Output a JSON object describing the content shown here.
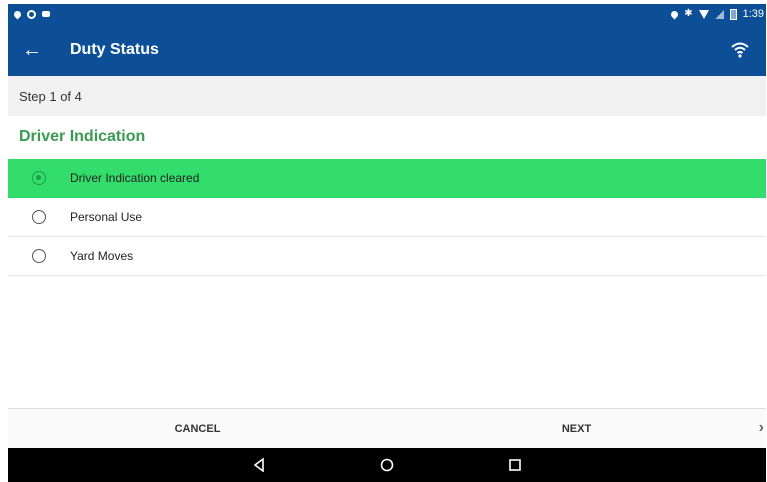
{
  "status_bar": {
    "time": "1:39",
    "left_icons": [
      "location-icon",
      "shield-icon",
      "message-icon"
    ],
    "right_icons": [
      "location-icon",
      "bluetooth-icon",
      "wifi-icon",
      "signal-icon",
      "battery-icon"
    ]
  },
  "app_bar": {
    "title": "Duty Status",
    "back_icon": "arrow-back-icon",
    "right_icon": "wifi-icon",
    "color": "#0d4f97"
  },
  "step": {
    "text": "Step 1 of 4"
  },
  "section": {
    "title": "Driver Indication",
    "color": "#3a9a52"
  },
  "options": [
    {
      "label": "Driver Indication cleared",
      "selected": true
    },
    {
      "label": "Personal Use",
      "selected": false
    },
    {
      "label": "Yard Moves",
      "selected": false
    }
  ],
  "selected_color": "#33dd6b",
  "footer": {
    "cancel_label": "CANCEL",
    "next_label": "NEXT",
    "chevron_icon": "chevron-right-icon"
  },
  "nav_bar": {
    "icons": [
      "back-triangle-icon",
      "home-circle-icon",
      "recents-square-icon"
    ]
  }
}
